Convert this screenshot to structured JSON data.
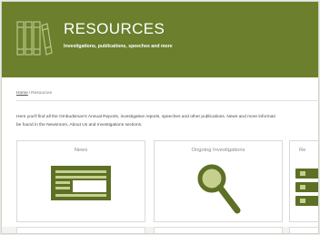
{
  "hero": {
    "title": "RESOURCES",
    "subtitle": "Investigations, publications, speeches and more",
    "bg_color": "#6b7f2c",
    "logo_icon": "books-icon"
  },
  "breadcrumb": {
    "home": "Home",
    "separator": "/",
    "current": "Resources"
  },
  "intro": {
    "line1": "Here you'll find all the Ombudsman's Annual Reports, investigative reports, speeches and other publications. News and more informati",
    "line2": "be found in the Newsroom, About Us and Investigations sections."
  },
  "cards": [
    {
      "label": "News",
      "icon": "newspaper-icon"
    },
    {
      "label": "Ongoing Investigations",
      "icon": "magnifier-icon"
    },
    {
      "label": "Re",
      "icon": "list-icon"
    }
  ],
  "colors": {
    "accent": "#6b7f2c",
    "icon_dark": "#5d7025",
    "icon_light": "#c5d08e"
  }
}
